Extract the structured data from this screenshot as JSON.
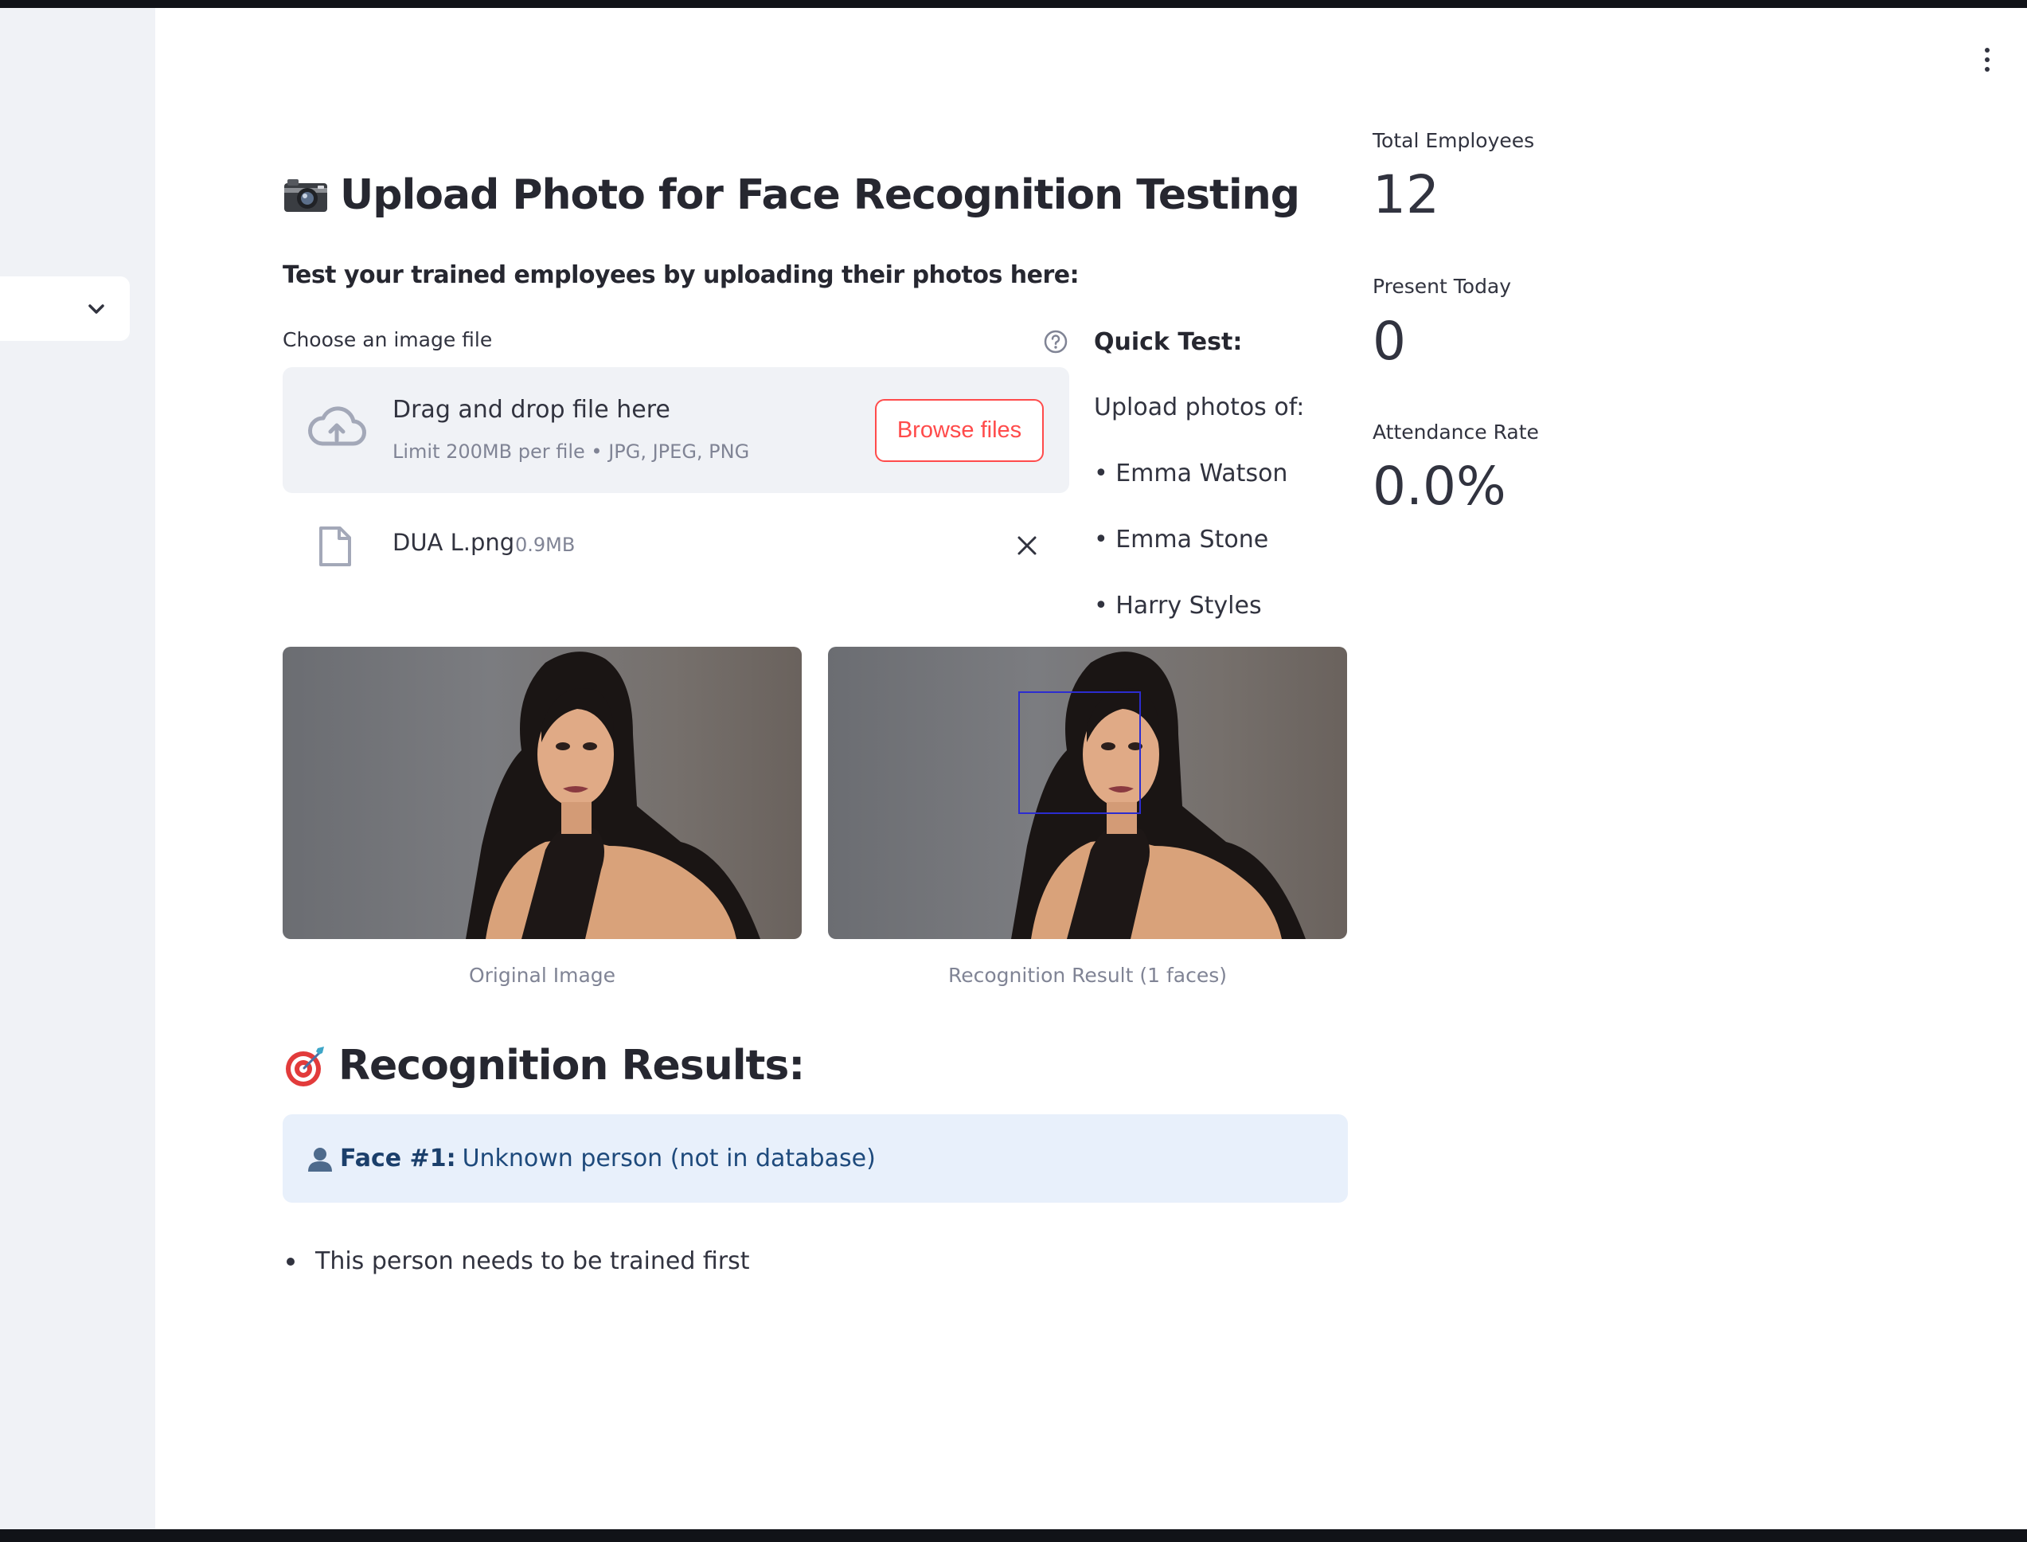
{
  "header": {
    "menu_icon": "vertical-ellipsis-icon"
  },
  "sidebar": {
    "collapse_icon": "chevron-down-icon"
  },
  "page": {
    "title_icon": "camera-emoji",
    "title": "Upload Photo for Face Recognition Testing",
    "subtitle": "Test your trained employees by uploading their photos here:"
  },
  "uploader": {
    "label": "Choose an image file",
    "help_icon": "question-circle-icon",
    "drop_text": "Drag and drop file here",
    "limit_text": "Limit 200MB per file • JPG, JPEG, PNG",
    "browse_label": "Browse files",
    "accent_color": "#ff4b4b",
    "file": {
      "name": "DUA L.png",
      "size": "0.9MB"
    }
  },
  "quick_test": {
    "title": "Quick Test:",
    "intro": "Upload photos of:",
    "names": [
      "• Emma Watson",
      "• Emma Stone",
      "• Harry Styles"
    ]
  },
  "metrics": [
    {
      "label": "Total Employees",
      "value": "12"
    },
    {
      "label": "Present Today",
      "value": "0"
    },
    {
      "label": "Attendance Rate",
      "value": "0.0%"
    }
  ],
  "images": {
    "original_caption": "Original Image",
    "result_caption": "Recognition Result (1 faces)"
  },
  "results": {
    "title_icon": "target-emoji",
    "title": "Recognition Results:",
    "face_label": "Face #1:",
    "face_text": "Unknown person (not in database)",
    "note": "This person needs to be trained first",
    "info_color": "#e8f0fb"
  }
}
